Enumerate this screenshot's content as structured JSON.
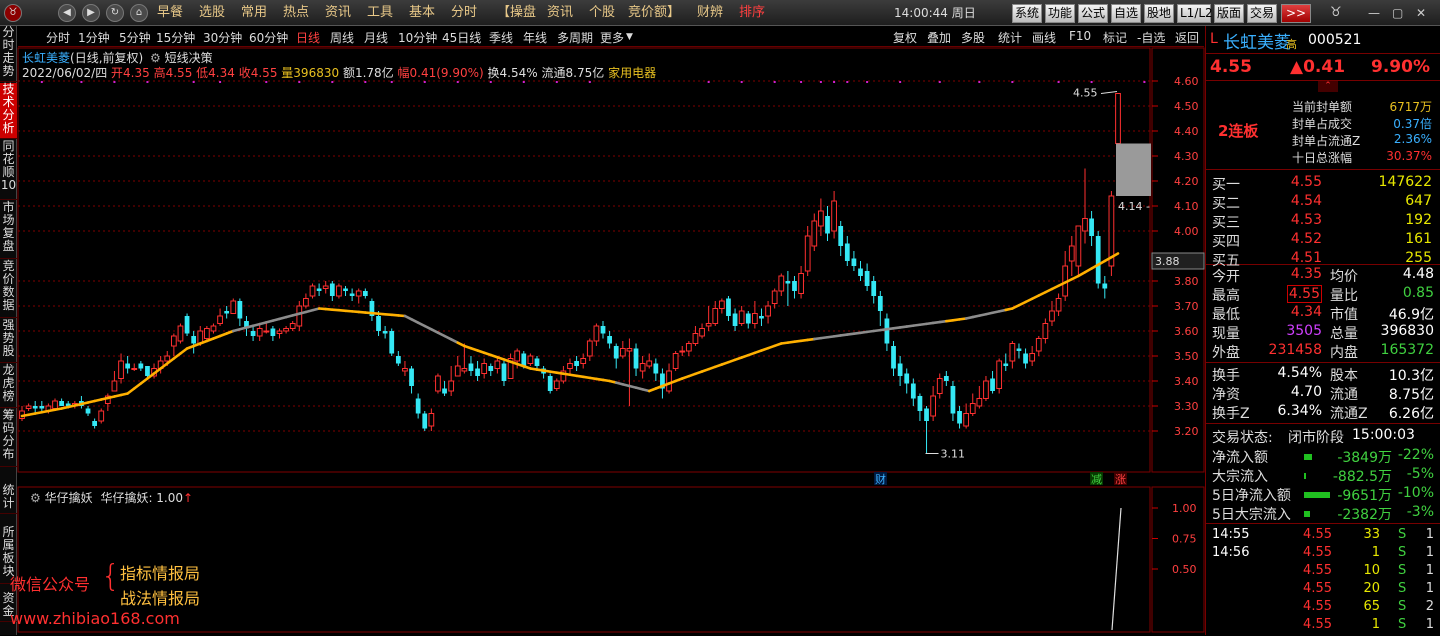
{
  "topbar": {
    "nav": [
      "◀",
      "▶",
      "↻"
    ],
    "menus": [
      "早餐",
      "选股",
      "常用",
      "热点",
      "资讯",
      "工具",
      "基本",
      "分时",
      "【操盘",
      "资讯",
      "个股",
      "竞价额】",
      "财辨",
      "排序"
    ],
    "clock": "14:00:44 周日",
    "buttons": [
      "系统",
      "功能",
      "公式",
      "自选",
      "股地",
      "L1/L2",
      "版面",
      "交易",
      ">>"
    ]
  },
  "left_tabs": [
    "分时走势",
    "技术分析",
    "同花顺10",
    "市场复盘",
    "竞价数据",
    "强势股",
    "龙虎榜",
    "筹码分布",
    "统计",
    "所属板块",
    "资金"
  ],
  "periods": [
    "分时",
    "1分钟",
    "5分钟",
    "15分钟",
    "30分钟",
    "60分钟",
    "日线",
    "周线",
    "月线",
    "10分钟",
    "45日线",
    "季线",
    "年线",
    "多周期",
    "更多"
  ],
  "toolbar": [
    "复权",
    "叠加",
    "多股",
    "统计",
    "画线",
    "F10",
    "标记",
    "-自选",
    "返回"
  ],
  "stock": {
    "name": "长虹美菱",
    "period_note": "(日线,前复权)",
    "tool": "短线决策",
    "date": "2022/06/02/四",
    "open": "开4.35",
    "high": "高4.55",
    "low": "低4.34",
    "close": "收4.55",
    "vol": "量396830",
    "amt": "额1.78亿",
    "chg": "幅0.41(9.90%)",
    "turnover": "换4.54%",
    "float": "流通8.75亿",
    "industry": "家用电器"
  },
  "watermark": {
    "a": "微信公众号",
    "b": "指标情报局",
    "c": "战法情报局",
    "url": "www.zhibiao168.com"
  },
  "chart_data": {
    "type": "candlestick",
    "yaxis": {
      "ticks": [
        "4.60",
        "4.50",
        "4.40",
        "4.30",
        "4.20",
        "4.10",
        "4.00",
        "3.80",
        "3.70",
        "3.60",
        "3.50",
        "3.40",
        "3.30",
        "3.20"
      ]
    },
    "candles": [
      [
        3.25,
        3.28,
        3.3,
        3.24
      ],
      [
        3.29,
        3.3,
        3.31,
        3.28
      ],
      [
        3.3,
        3.29,
        3.32,
        3.27
      ],
      [
        3.3,
        3.29,
        3.32,
        3.28
      ],
      [
        3.28,
        3.3,
        3.31,
        3.27
      ],
      [
        3.29,
        3.32,
        3.33,
        3.28
      ],
      [
        3.32,
        3.3,
        3.33,
        3.3
      ],
      [
        3.31,
        3.3,
        3.32,
        3.29
      ],
      [
        3.3,
        3.31,
        3.32,
        3.29
      ],
      [
        3.32,
        3.3,
        3.34,
        3.29
      ],
      [
        3.29,
        3.27,
        3.3,
        3.26
      ],
      [
        3.24,
        3.22,
        3.25,
        3.21
      ],
      [
        3.24,
        3.28,
        3.29,
        3.23
      ],
      [
        3.31,
        3.34,
        3.35,
        3.28
      ],
      [
        3.36,
        3.4,
        3.44,
        3.36
      ],
      [
        3.41,
        3.48,
        3.51,
        3.39
      ],
      [
        3.47,
        3.45,
        3.5,
        3.43
      ],
      [
        3.45,
        3.45,
        3.47,
        3.44
      ],
      [
        3.47,
        3.45,
        3.48,
        3.44
      ],
      [
        3.46,
        3.42,
        3.46,
        3.41
      ],
      [
        3.42,
        3.45,
        3.47,
        3.41
      ],
      [
        3.45,
        3.48,
        3.5,
        3.43
      ],
      [
        3.48,
        3.5,
        3.52,
        3.46
      ],
      [
        3.54,
        3.58,
        3.59,
        3.5
      ],
      [
        3.56,
        3.62,
        3.63,
        3.55
      ],
      [
        3.66,
        3.59,
        3.67,
        3.58
      ],
      [
        3.58,
        3.55,
        3.6,
        3.51
      ],
      [
        3.55,
        3.6,
        3.62,
        3.54
      ],
      [
        3.57,
        3.61,
        3.62,
        3.56
      ],
      [
        3.6,
        3.62,
        3.63,
        3.59
      ],
      [
        3.63,
        3.66,
        3.69,
        3.62
      ],
      [
        3.68,
        3.67,
        3.7,
        3.65
      ],
      [
        3.67,
        3.72,
        3.73,
        3.67
      ],
      [
        3.72,
        3.65,
        3.73,
        3.62
      ],
      [
        3.64,
        3.61,
        3.66,
        3.58
      ],
      [
        3.6,
        3.58,
        3.62,
        3.56
      ],
      [
        3.58,
        3.61,
        3.63,
        3.56
      ],
      [
        3.6,
        3.6,
        3.63,
        3.59
      ],
      [
        3.61,
        3.58,
        3.62,
        3.56
      ],
      [
        3.59,
        3.6,
        3.61,
        3.57
      ],
      [
        3.6,
        3.61,
        3.62,
        3.59
      ],
      [
        3.61,
        3.63,
        3.64,
        3.6
      ],
      [
        3.62,
        3.7,
        3.72,
        3.6
      ],
      [
        3.7,
        3.73,
        3.75,
        3.69
      ],
      [
        3.74,
        3.78,
        3.79,
        3.73
      ],
      [
        3.77,
        3.76,
        3.79,
        3.74
      ],
      [
        3.77,
        3.78,
        3.8,
        3.75
      ],
      [
        3.79,
        3.74,
        3.8,
        3.72
      ],
      [
        3.74,
        3.78,
        3.79,
        3.73
      ],
      [
        3.77,
        3.76,
        3.78,
        3.74
      ],
      [
        3.75,
        3.74,
        3.77,
        3.72
      ],
      [
        3.74,
        3.76,
        3.77,
        3.71
      ],
      [
        3.76,
        3.74,
        3.77,
        3.73
      ],
      [
        3.72,
        3.66,
        3.73,
        3.64
      ],
      [
        3.66,
        3.6,
        3.68,
        3.58
      ],
      [
        3.6,
        3.59,
        3.62,
        3.57
      ],
      [
        3.6,
        3.51,
        3.61,
        3.5
      ],
      [
        3.5,
        3.47,
        3.52,
        3.46
      ],
      [
        3.44,
        3.45,
        3.48,
        3.42
      ],
      [
        3.45,
        3.38,
        3.46,
        3.35
      ],
      [
        3.33,
        3.27,
        3.35,
        3.25
      ],
      [
        3.27,
        3.21,
        3.28,
        3.2
      ],
      [
        3.22,
        3.27,
        3.29,
        3.2
      ],
      [
        3.36,
        3.42,
        3.43,
        3.35
      ],
      [
        3.37,
        3.35,
        3.4,
        3.34
      ],
      [
        3.36,
        3.4,
        3.46,
        3.34
      ],
      [
        3.42,
        3.46,
        3.5,
        3.42
      ],
      [
        3.44,
        3.45,
        3.55,
        3.43
      ],
      [
        3.47,
        3.44,
        3.5,
        3.42
      ],
      [
        3.45,
        3.42,
        3.48,
        3.4
      ],
      [
        3.43,
        3.47,
        3.49,
        3.41
      ],
      [
        3.46,
        3.44,
        3.47,
        3.42
      ],
      [
        3.45,
        3.48,
        3.5,
        3.43
      ],
      [
        3.47,
        3.4,
        3.48,
        3.38
      ],
      [
        3.41,
        3.49,
        3.51,
        3.41
      ],
      [
        3.48,
        3.52,
        3.53,
        3.45
      ],
      [
        3.51,
        3.46,
        3.52,
        3.45
      ],
      [
        3.47,
        3.5,
        3.51,
        3.46
      ],
      [
        3.49,
        3.46,
        3.5,
        3.44
      ],
      [
        3.45,
        3.43,
        3.46,
        3.41
      ],
      [
        3.42,
        3.36,
        3.43,
        3.35
      ],
      [
        3.37,
        3.4,
        3.41,
        3.36
      ],
      [
        3.4,
        3.44,
        3.46,
        3.39
      ],
      [
        3.45,
        3.47,
        3.49,
        3.43
      ],
      [
        3.48,
        3.46,
        3.5,
        3.44
      ],
      [
        3.47,
        3.49,
        3.51,
        3.45
      ],
      [
        3.5,
        3.56,
        3.57,
        3.48
      ],
      [
        3.56,
        3.62,
        3.63,
        3.54
      ],
      [
        3.62,
        3.59,
        3.64,
        3.57
      ],
      [
        3.58,
        3.55,
        3.6,
        3.53
      ],
      [
        3.54,
        3.49,
        3.55,
        3.45
      ],
      [
        3.5,
        3.53,
        3.56,
        3.49
      ],
      [
        3.52,
        3.53,
        3.57,
        3.3
      ],
      [
        3.53,
        3.45,
        3.55,
        3.42
      ],
      [
        3.44,
        3.47,
        3.5,
        3.41
      ],
      [
        3.46,
        3.48,
        3.51,
        3.45
      ],
      [
        3.47,
        3.43,
        3.49,
        3.4
      ],
      [
        3.43,
        3.37,
        3.45,
        3.33
      ],
      [
        3.36,
        3.44,
        3.47,
        3.35
      ],
      [
        3.45,
        3.51,
        3.52,
        3.44
      ],
      [
        3.52,
        3.52,
        3.54,
        3.5
      ],
      [
        3.52,
        3.55,
        3.56,
        3.5
      ],
      [
        3.55,
        3.59,
        3.62,
        3.54
      ],
      [
        3.58,
        3.61,
        3.63,
        3.57
      ],
      [
        3.62,
        3.63,
        3.7,
        3.6
      ],
      [
        3.63,
        3.69,
        3.72,
        3.62
      ],
      [
        3.69,
        3.72,
        3.73,
        3.67
      ],
      [
        3.73,
        3.66,
        3.74,
        3.64
      ],
      [
        3.67,
        3.62,
        3.69,
        3.6
      ],
      [
        3.63,
        3.68,
        3.7,
        3.62
      ],
      [
        3.67,
        3.63,
        3.68,
        3.61
      ],
      [
        3.63,
        3.67,
        3.72,
        3.61
      ],
      [
        3.66,
        3.65,
        3.69,
        3.62
      ],
      [
        3.66,
        3.7,
        3.72,
        3.63
      ],
      [
        3.71,
        3.76,
        3.77,
        3.69
      ],
      [
        3.76,
        3.82,
        3.83,
        3.74
      ],
      [
        3.8,
        3.79,
        3.84,
        3.7
      ],
      [
        3.8,
        3.76,
        3.82,
        3.73
      ],
      [
        3.75,
        3.83,
        3.86,
        3.73
      ],
      [
        3.84,
        3.98,
        4.02,
        3.82
      ],
      [
        3.94,
        4.04,
        4.07,
        3.92
      ],
      [
        4.02,
        4.08,
        4.13,
        3.98
      ],
      [
        4.06,
        3.99,
        4.1,
        3.96
      ],
      [
        4.0,
        4.12,
        4.16,
        3.97
      ],
      [
        4.02,
        3.94,
        4.04,
        3.9
      ],
      [
        3.95,
        3.88,
        3.98,
        3.86
      ],
      [
        3.89,
        3.86,
        3.92,
        3.84
      ],
      [
        3.85,
        3.82,
        3.88,
        3.8
      ],
      [
        3.84,
        3.78,
        3.87,
        3.76
      ],
      [
        3.8,
        3.74,
        3.82,
        3.71
      ],
      [
        3.74,
        3.68,
        3.76,
        3.62
      ],
      [
        3.65,
        3.55,
        3.67,
        3.52
      ],
      [
        3.54,
        3.45,
        3.56,
        3.42
      ],
      [
        3.47,
        3.42,
        3.5,
        3.38
      ],
      [
        3.43,
        3.39,
        3.45,
        3.35
      ],
      [
        3.39,
        3.33,
        3.41,
        3.3
      ],
      [
        3.34,
        3.28,
        3.35,
        3.24
      ],
      [
        3.29,
        3.24,
        3.3,
        3.11
      ],
      [
        3.26,
        3.34,
        3.38,
        3.24
      ],
      [
        3.35,
        3.41,
        3.43,
        3.33
      ],
      [
        3.42,
        3.4,
        3.44,
        3.38
      ],
      [
        3.38,
        3.27,
        3.4,
        3.24
      ],
      [
        3.28,
        3.23,
        3.3,
        3.21
      ],
      [
        3.22,
        3.27,
        3.31,
        3.21
      ],
      [
        3.27,
        3.31,
        3.35,
        3.26
      ],
      [
        3.3,
        3.33,
        3.38,
        3.29
      ],
      [
        3.33,
        3.4,
        3.42,
        3.32
      ],
      [
        3.41,
        3.36,
        3.44,
        3.35
      ],
      [
        3.37,
        3.48,
        3.49,
        3.35
      ],
      [
        3.47,
        3.46,
        3.51,
        3.44
      ],
      [
        3.48,
        3.55,
        3.56,
        3.45
      ],
      [
        3.53,
        3.52,
        3.55,
        3.49
      ],
      [
        3.51,
        3.47,
        3.53,
        3.45
      ],
      [
        3.48,
        3.51,
        3.54,
        3.46
      ],
      [
        3.52,
        3.57,
        3.58,
        3.5
      ],
      [
        3.57,
        3.63,
        3.65,
        3.55
      ],
      [
        3.64,
        3.68,
        3.72,
        3.62
      ],
      [
        3.68,
        3.73,
        3.75,
        3.66
      ],
      [
        3.74,
        3.86,
        3.92,
        3.72
      ],
      [
        3.88,
        3.94,
        3.98,
        3.82
      ],
      [
        3.86,
        4.02,
        4.02,
        3.82
      ],
      [
        4.0,
        4.05,
        4.25,
        3.95
      ],
      [
        4.05,
        3.98,
        4.08,
        3.94
      ],
      [
        3.98,
        3.79,
        4.0,
        3.77
      ],
      [
        3.79,
        3.77,
        3.82,
        3.73
      ],
      [
        3.86,
        4.14,
        4.16,
        3.82
      ],
      [
        4.35,
        4.55,
        4.55,
        4.34
      ]
    ],
    "ma": [
      [
        0,
        3.26
      ],
      [
        6,
        3.29
      ],
      [
        16,
        3.35
      ],
      [
        25,
        3.53
      ],
      [
        32,
        3.6
      ],
      [
        45,
        3.69
      ],
      [
        58,
        3.66
      ],
      [
        67,
        3.54
      ],
      [
        77,
        3.45
      ],
      [
        89,
        3.4
      ],
      [
        95,
        3.36
      ],
      [
        100,
        3.41
      ],
      [
        115,
        3.55
      ],
      [
        129,
        3.6
      ],
      [
        143,
        3.65
      ],
      [
        150,
        3.69
      ],
      [
        160,
        3.82
      ],
      [
        170,
        3.97
      ],
      [
        174,
        3.86
      ]
    ],
    "ma_gray_segments": [
      [
        32,
        45
      ],
      [
        58,
        66
      ],
      [
        90,
        95
      ],
      [
        120,
        140
      ],
      [
        143,
        149
      ]
    ],
    "high_label": "4.55",
    "low_label": "3.11",
    "right_label": "4.14",
    "cursor_price": "3.88",
    "markers": {
      "cai": "财",
      "jian": "减",
      "zhang": "涨"
    },
    "indicator": {
      "title": "华仔擒妖",
      "name": "华仔擒妖: 1.00",
      "ticks": [
        "1.00",
        "0.75",
        "0.50"
      ],
      "values": [
        0,
        0,
        0,
        0,
        0,
        0,
        0,
        1
      ]
    }
  },
  "side": {
    "title": "长虹美菱",
    "flag": "L",
    "sub": "高",
    "code": "000521",
    "price": "4.55",
    "change": "▲0.41",
    "pct": "9.90%",
    "streak": "2连板",
    "seal": [
      {
        "k": "当前封单额",
        "v": "6717万"
      },
      {
        "k": "封单占成交",
        "v": "0.37倍"
      },
      {
        "k": "封单占流通Z",
        "v": "2.36%"
      },
      {
        "k": "十日总涨幅",
        "v": "30.37%"
      }
    ],
    "book": [
      {
        "k": "买一",
        "p": "4.55",
        "v": "147622"
      },
      {
        "k": "买二",
        "p": "4.54",
        "v": "647"
      },
      {
        "k": "买三",
        "p": "4.53",
        "v": "192"
      },
      {
        "k": "买四",
        "p": "4.52",
        "v": "161"
      },
      {
        "k": "买五",
        "p": "4.51",
        "v": "255"
      }
    ],
    "quote": [
      [
        "今开",
        "4.35",
        "均价",
        "4.48"
      ],
      [
        "最高",
        "4.55",
        "量比",
        "0.85"
      ],
      [
        "最低",
        "4.34",
        "市值",
        "46.9亿"
      ],
      [
        "现量",
        "3505",
        "总量",
        "396830"
      ],
      [
        "外盘",
        "231458",
        "内盘",
        "165372"
      ]
    ],
    "stats": [
      [
        "换手",
        "4.54%",
        "股本",
        "10.3亿"
      ],
      [
        "净资",
        "4.70",
        "流通",
        "8.75亿"
      ],
      [
        "换手Z",
        "6.34%",
        "流通Z",
        "6.26亿"
      ]
    ],
    "status": {
      "label": "交易状态:",
      "value": "闭市阶段",
      "time": "15:00:03"
    },
    "flows": [
      {
        "k": "净流入额",
        "v": "-3849万",
        "p": "-22%"
      },
      {
        "k": "大宗流入",
        "v": "-882.5万",
        "p": "-5%"
      },
      {
        "k": "5日净流入额",
        "v": "-9651万",
        "p": "-10%"
      },
      {
        "k": "5日大宗流入",
        "v": "-2382万",
        "p": "-3%"
      }
    ],
    "ticks": [
      [
        "14:55",
        "4.55",
        "33",
        "S",
        "1"
      ],
      [
        "14:56",
        "4.55",
        "1",
        "S",
        "1"
      ],
      [
        "",
        "4.55",
        "10",
        "S",
        "1"
      ],
      [
        "",
        "4.55",
        "20",
        "S",
        "1"
      ],
      [
        "",
        "4.55",
        "65",
        "S",
        "2"
      ],
      [
        "",
        "4.55",
        "1",
        "S",
        "1"
      ]
    ]
  },
  "colors": {
    "up": "#ff3030",
    "down": "#35e8f5",
    "ma": "#ffb000",
    "gray": "#8c8c8c",
    "bg": "#000000",
    "grid": "#800000"
  }
}
